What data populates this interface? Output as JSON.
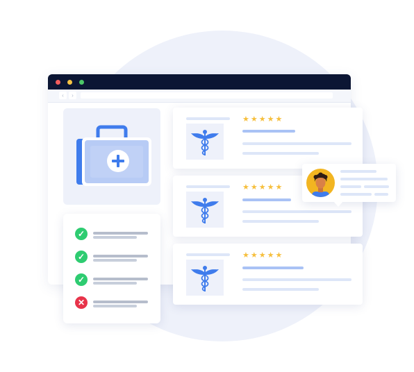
{
  "browser": {
    "window_dots": [
      "close",
      "minimize",
      "maximize"
    ],
    "nav": {
      "back_icon": "‹",
      "forward_icon": "›"
    }
  },
  "medkit": {
    "icon": "medical-kit-icon",
    "cross": "+"
  },
  "checklist": {
    "items": [
      {
        "status": "ok",
        "glyph": "✓"
      },
      {
        "status": "ok",
        "glyph": "✓"
      },
      {
        "status": "ok",
        "glyph": "✓"
      },
      {
        "status": "error",
        "glyph": "✕"
      }
    ]
  },
  "reviews": [
    {
      "stars": "★★★★★",
      "rating": 5,
      "icon": "caduceus-icon"
    },
    {
      "stars": "★★★★★",
      "rating": 5,
      "icon": "caduceus-icon"
    },
    {
      "stars": "★★★★★",
      "rating": 5,
      "icon": "caduceus-icon"
    }
  ],
  "comment": {
    "avatar": "user-avatar"
  },
  "colors": {
    "titlebar": "#0c1634",
    "accent_blue": "#3f7cec",
    "star": "#f6bf3d",
    "ok_green": "#2ecc71",
    "error_red": "#e8334a",
    "background_circle": "#eef1fa"
  }
}
